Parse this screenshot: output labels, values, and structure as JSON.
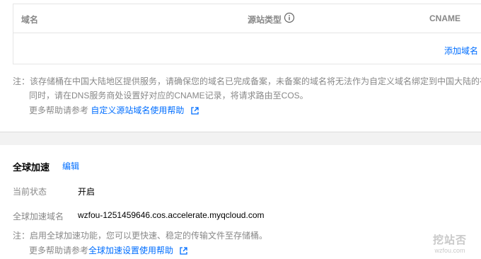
{
  "domain_table": {
    "columns": [
      "域名",
      "源站类型",
      "CNAME"
    ],
    "add_domain_label": "添加域名"
  },
  "domain_note": {
    "line1": "注：该存储桶在中国大陆地区提供服务，请确保您的域名已完成备案，未备案的域名将无法作为自定义域名绑定到中国大陆的存",
    "line2": "同时，请在DNS服务商处设置好对应的CNAME记录，将请求路由至COS。",
    "help_prefix": "更多帮助请参考",
    "help_link": "自定义源站域名使用帮助"
  },
  "global_accel": {
    "title": "全球加速",
    "edit_label": "编辑",
    "status_label": "当前状态",
    "status_value": "开启",
    "domain_label": "全球加速域名",
    "domain_value": "wzfou-1251459646.cos.accelerate.myqcloud.com",
    "note": "注：启用全球加速功能，您可以更快速、稳定的传输文件至存储桶。",
    "help_prefix": "更多帮助请参考",
    "help_link": "全球加速设置使用帮助"
  },
  "watermark": {
    "logo": "挖站否",
    "url": "wzfou.com"
  },
  "colors": {
    "link": "#006eff",
    "muted": "#888888",
    "background": "#f2f2f2"
  },
  "icons": [
    "info-icon",
    "external-link-icon"
  ]
}
